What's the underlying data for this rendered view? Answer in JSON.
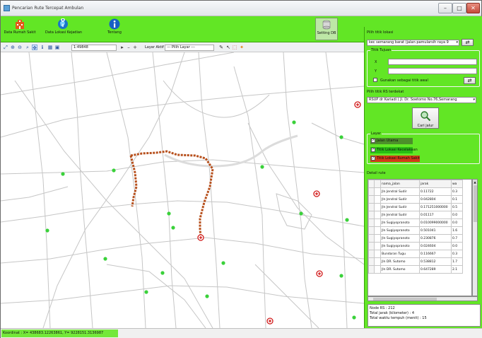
{
  "window": {
    "title": "Pencarian Rute Tercepat Ambulan",
    "min_glyph": "–",
    "max_glyph": "□",
    "close_glyph": "✕"
  },
  "toolbar": {
    "data_rumah_sakit": "Data Rumah Sakit",
    "data_lokasi_kejadian": "Data Lokasi Kejadian",
    "tentang": "Tentang",
    "setting_db": "Setting DB"
  },
  "map_toolbar": {
    "zoom_value": "1:49848",
    "layer_aktif_label": "Layar Aktif",
    "layer_select": "--- Pilih Layar ---"
  },
  "status": {
    "coordinate": "Koordinat : X= 438683.12263861, Y= 9228151.3136987"
  },
  "panel": {
    "pilih_titik_label": "Pilih titik lokasi",
    "pilih_titik_value": "kec semarang barat (jalan pamularsih raya 9",
    "titik_tujuan_label": "Titik Tujuan",
    "x_label": "X",
    "y_label": "Y",
    "x_value": "",
    "y_value": "",
    "gunakan_label": "Gunakan sebagai titik awal",
    "rs_label": "Pilih titik RS terdekat",
    "rs_value": "RSUP dr Kariadi ( Jl. Dr. Soetomo No.76,Semarang",
    "cari_jalur": "Cari jalur",
    "layer_group_label": "Layar",
    "layers": [
      {
        "label": "Jalan Utama",
        "checked": "✓",
        "color": "#4c8f2a"
      },
      {
        "label": "Titik Lokasi Kecelakaan",
        "checked": "✓",
        "color": "#28bd14"
      },
      {
        "label": "Titik Lokasi Rumah Sakit",
        "checked": "✓",
        "color": "#d33a18"
      }
    ],
    "detail_label": "Detail rute",
    "grid_headers": [
      "nama_jalan",
      "jarak",
      "wa"
    ],
    "grid_rows": [
      [
        "Jln Jendral Sudir",
        "0.11722",
        "0.3"
      ],
      [
        "Jln Jendral Sudir",
        "0.042804",
        "0.1"
      ],
      [
        "Jln Jendral Sudir",
        "0.171251000000",
        "0.5"
      ],
      [
        "Jln Jendral Sudir",
        "0.01117",
        "0.0"
      ],
      [
        "Jln Sugiyopranoto",
        "0.010099000000",
        "0.0"
      ],
      [
        "Jln Sugiyopranoto",
        "0.501041",
        "1.6"
      ],
      [
        "Jln Sugiyopranoto",
        "0.230876",
        "0.7"
      ],
      [
        "Jln Sugiyopranoto",
        "0.024604",
        "0.0"
      ],
      [
        "Bundaran Tugu",
        "0.116667",
        "0.3"
      ],
      [
        "Jln DR. Sutomo",
        "0.538812",
        "1.7"
      ],
      [
        "Jln DR. Sutomo",
        "0.647289",
        "2.1"
      ]
    ],
    "node_rs": "Node RS : 212",
    "total_jarak": "Total jarak (kilometer) : 4",
    "total_waktu": "Total waktu tempuh (menit) : 15"
  }
}
